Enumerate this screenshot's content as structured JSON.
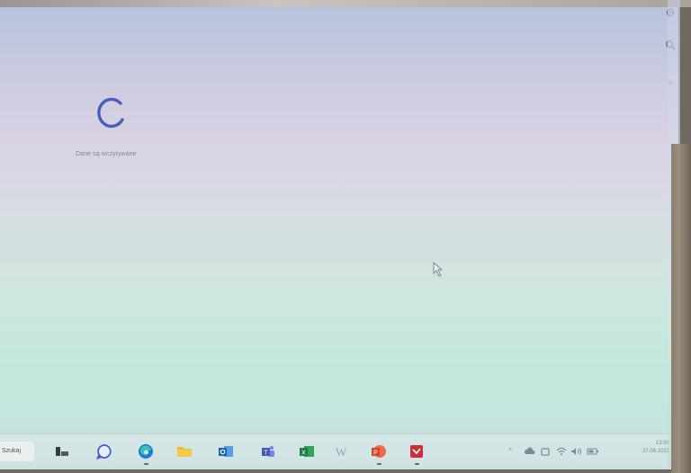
{
  "screen": {
    "loading_text": "Dane są wczytywane"
  },
  "sidebar": {
    "icons": [
      "gear-icon",
      "search-icon",
      "plus-icon"
    ]
  },
  "taskbar": {
    "search_label": "Szukaj",
    "apps": [
      {
        "name": "task-view-icon"
      },
      {
        "name": "chat-icon"
      },
      {
        "name": "edge-icon"
      },
      {
        "name": "file-explorer-icon"
      },
      {
        "name": "outlook-icon"
      },
      {
        "name": "teams-icon"
      },
      {
        "name": "excel-icon"
      },
      {
        "name": "word-icon"
      },
      {
        "name": "powerpoint-icon"
      },
      {
        "name": "pdf-icon"
      }
    ],
    "tray_chevron": "^",
    "clock": {
      "time": "13:50",
      "date": "27.06.2023"
    }
  },
  "colors": {
    "spinner": "#4a5fb8",
    "edge": "#1a7fd0",
    "excel": "#1e7a45",
    "powerpoint": "#d24726",
    "pdf": "#cc2f3a"
  }
}
